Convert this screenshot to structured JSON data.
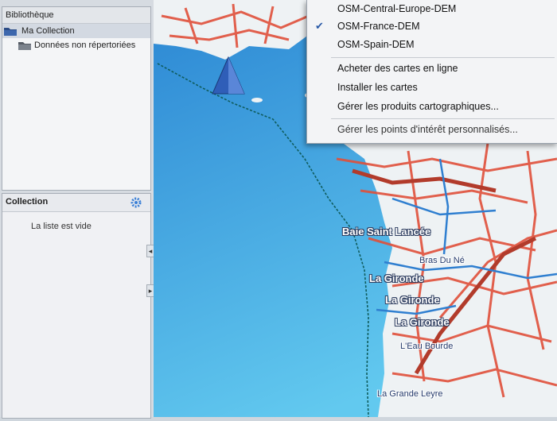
{
  "library": {
    "header": "Bibliothèque",
    "items": [
      {
        "label": "Ma Collection"
      },
      {
        "label": "Données non répertoriées"
      }
    ]
  },
  "collection": {
    "header": "Collection",
    "empty_text": "La liste est vide"
  },
  "menu": {
    "items": [
      {
        "label": "OSM-Central-Europe-DEM",
        "checked": false
      },
      {
        "label": "OSM-France-DEM",
        "checked": true
      },
      {
        "label": "OSM-Spain-DEM",
        "checked": false
      },
      {
        "label": "Acheter des cartes en ligne"
      },
      {
        "label": "Installer les cartes"
      },
      {
        "label": "Gérer les produits cartographiques..."
      },
      {
        "label": "Gérer les points d'intérêt personnalisés..."
      }
    ],
    "check_glyph": "✔"
  },
  "map": {
    "labels": [
      {
        "text": "Baie Saint Lancée"
      },
      {
        "text": "Bras Du Né"
      },
      {
        "text": "La Gironde"
      },
      {
        "text": "La Gironde"
      },
      {
        "text": "La Gironde"
      },
      {
        "text": "L'Eau Bourde"
      },
      {
        "text": "La Grande Leyre"
      }
    ]
  },
  "colors": {
    "sea_top": "#2d8fd8",
    "sea_bottom": "#5cc6ee",
    "land": "#eef2f4",
    "road": "#e0503a",
    "river": "#2f7fd0",
    "accent": "#2a5aa8"
  }
}
